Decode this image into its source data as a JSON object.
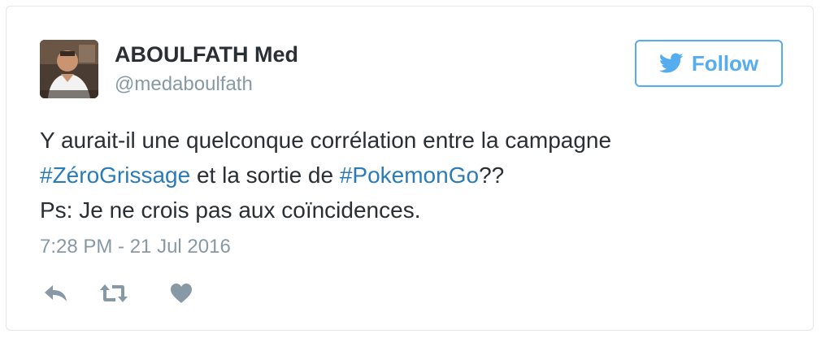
{
  "author": {
    "display_name": "ABOULFATH Med",
    "handle": "@medaboulfath"
  },
  "follow_button": {
    "label": "Follow",
    "icon": "twitter-bird-icon",
    "color": "#55acee"
  },
  "tweet": {
    "line1": "Y aurait-il une quelconque corrélation entre la campagne",
    "hashtag1": "#ZéroGrissage",
    "mid_text": " et la sortie de ",
    "hashtag2": "#PokemonGo",
    "tail_text": "??",
    "line3": "Ps: Je ne crois pas aux coïncidences.",
    "hashtag_color": "#2b7bb9"
  },
  "timestamp": "7:28 PM - 21 Jul 2016",
  "actions": [
    {
      "icon": "reply-icon"
    },
    {
      "icon": "retweet-icon"
    },
    {
      "icon": "like-heart-icon"
    }
  ]
}
